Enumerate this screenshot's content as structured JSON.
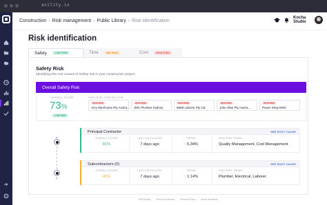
{
  "browser": {
    "url": "anility.io"
  },
  "header": {
    "breadcrumbs": [
      "Construction",
      "Risk management",
      "Public Library",
      "Risk identification"
    ],
    "org_name_line1": "Kocha",
    "org_name_line2": "Studio"
  },
  "page": {
    "title": "Risk identification"
  },
  "tabs": [
    {
      "label": "Safety",
      "badge": "LOW RISK",
      "badge_level": "low"
    },
    {
      "label": "Time",
      "badge": "MID RISK",
      "badge_level": "mid"
    },
    {
      "label": "Cost",
      "badge": "HIGH RISK",
      "badge_level": "high"
    }
  ],
  "card": {
    "title": "Safety Risk",
    "subtitle": "Identifying the root causes of Safety risk in your construction project",
    "overall_title": "Overall Safety Risk",
    "overall_label": "OVERALL SCORE",
    "overall_score": "73",
    "overall_unit": "%",
    "overall_badge": "LOW RISK",
    "contractors_label": "HIGH RISK CONTRACTOR",
    "contractors": [
      {
        "badge": "HIGH RISK",
        "name": "Amy Wirehouse Pty Austra..."
      },
      {
        "badge": "HIGH RISK",
        "name": "JMC Plumber Sydney"
      },
      {
        "badge": "HIGH RISK",
        "name": "M&M Laborer Pty Ltd"
      },
      {
        "badge": "HIGH RISK",
        "name": "John Allan Pty Austra..."
      },
      {
        "badge": "HIGH RISK",
        "name": "Power Shop DMC"
      }
    ]
  },
  "rows": [
    {
      "name": "Principal Contractor",
      "link": "SEE ROOT CAUSE",
      "stripe_color": "#2dba86",
      "score_label": "OVERALL SCORE",
      "score": "81%",
      "score_color": "#2dba86",
      "calc_label": "LAST CALCULATED",
      "calc": "7 days ago",
      "trend_label": "TREND",
      "trend": "5.34%",
      "cause_label": "HIGH RISK TRADE",
      "cause": "Quality Management, Cost Management"
    },
    {
      "name": "Subcontractors (0)",
      "link": "SEE ROOT CAUSE",
      "stripe_color": "#f2b02b",
      "score_label": "OVERALL SCORE",
      "score": "46%",
      "score_color": "#f2b02b",
      "calc_label": "LAST CALCULATED",
      "calc": "7 days ago",
      "trend_label": "TREND",
      "trend": "1.14%",
      "cause_label": "HIGH RISK TRADE",
      "cause": "Plumber, Electrical, Laborer"
    }
  ],
  "footer": [
    "2025 Anility",
    "Terms of Service",
    "Privacy Policy",
    "Need feedback"
  ],
  "colors": {
    "accent": "#6b0fe0",
    "sidebar": "#1f2444",
    "low": "#2dba86",
    "mid": "#f2b02b",
    "high": "#e04848"
  }
}
